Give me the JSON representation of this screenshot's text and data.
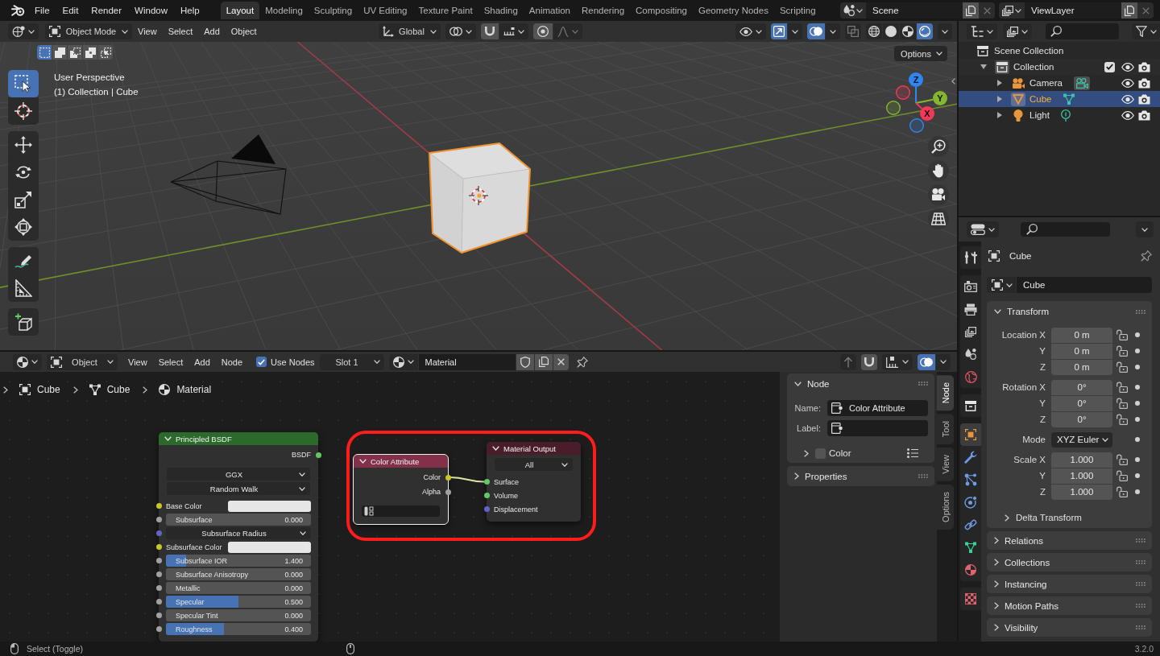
{
  "topbar": {
    "menus": [
      "File",
      "Edit",
      "Render",
      "Window",
      "Help"
    ],
    "workspaces": [
      {
        "label": "Layout",
        "selected": true
      },
      {
        "label": "Modeling",
        "selected": false
      },
      {
        "label": "Sculpting",
        "selected": false
      },
      {
        "label": "UV Editing",
        "selected": false
      },
      {
        "label": "Texture Paint",
        "selected": false
      },
      {
        "label": "Shading",
        "selected": false
      },
      {
        "label": "Animation",
        "selected": false
      },
      {
        "label": "Rendering",
        "selected": false
      },
      {
        "label": "Compositing",
        "selected": false
      },
      {
        "label": "Geometry Nodes",
        "selected": false
      },
      {
        "label": "Scripting",
        "selected": false
      }
    ],
    "scene": "Scene",
    "view_layer": "ViewLayer"
  },
  "viewport": {
    "mode": "Object Mode",
    "menus": [
      "View",
      "Select",
      "Add",
      "Object"
    ],
    "orientation": "Global",
    "gizmos_on": true,
    "overlays_on": true,
    "shading": [
      {
        "kind": "wireframe",
        "selected": false
      },
      {
        "kind": "solid",
        "selected": false
      },
      {
        "kind": "material",
        "selected": false
      },
      {
        "kind": "rendered",
        "selected": true
      }
    ],
    "select_modes": [
      {
        "kind": "set",
        "selected": true
      },
      {
        "kind": "extend",
        "selected": false
      },
      {
        "kind": "subtract",
        "selected": false
      },
      {
        "kind": "invert",
        "selected": false
      },
      {
        "kind": "intersect",
        "selected": false
      }
    ],
    "tool_groups": [
      {
        "tools": [
          {
            "kind": "select_box",
            "selected": true
          },
          {
            "kind": "cursor",
            "selected": false
          }
        ]
      },
      {
        "tools": [
          {
            "kind": "move",
            "selected": false
          },
          {
            "kind": "rotate",
            "selected": false
          },
          {
            "kind": "scale",
            "selected": false
          },
          {
            "kind": "transform",
            "selected": false
          }
        ]
      },
      {
        "tools": [
          {
            "kind": "annotate",
            "selected": false
          },
          {
            "kind": "measure",
            "selected": false
          }
        ]
      },
      {
        "tools": [
          {
            "kind": "add_cube",
            "selected": false
          }
        ]
      }
    ],
    "info": [
      "User Perspective",
      "(1) Collection | Cube"
    ],
    "options": "Options",
    "gizmo_axes": [
      {
        "label": "Z",
        "color": "#2f86f0"
      },
      {
        "label": "Y",
        "color": "#84b62f"
      },
      {
        "label": "X",
        "color": "#f5375a"
      }
    ]
  },
  "node_editor": {
    "shader_type": "Object",
    "menus": [
      "View",
      "Select",
      "Add",
      "Node"
    ],
    "use_nodes": {
      "label": "Use Nodes",
      "checked": true
    },
    "slot": "Slot 1",
    "material": "Material",
    "overlays_on": true,
    "breadcrumbs": [
      {
        "kind": "object",
        "label": "Cube"
      },
      {
        "kind": "mesh",
        "label": "Cube"
      },
      {
        "kind": "material",
        "label": "Material"
      }
    ],
    "nodes": [
      {
        "title": "Principled BSDF",
        "color": "#2c6a2c",
        "selected": false,
        "outputs": [
          {
            "label": "BSDF",
            "color": "#63c763"
          }
        ],
        "options": [
          "GGX",
          "Random Walk"
        ],
        "inputs": [
          {
            "label": "Base Color",
            "color": "#c7c729",
            "kind": "swatch",
            "swatch": {
              "color": "#e6e6e6"
            }
          },
          {
            "label": "Subsurface",
            "color": "#a1a1a1",
            "kind": "slider",
            "value": "0.000",
            "level": 0
          },
          {
            "label": "Subsurface Radius",
            "color": "#6363c7",
            "kind": "vector"
          },
          {
            "label": "Subsurface Color",
            "color": "#c7c729",
            "kind": "swatch",
            "swatch": {
              "color": "#e6e6e6"
            }
          },
          {
            "label": "Subsurface IOR",
            "color": "#a1a1a1",
            "kind": "slider",
            "value": "1.400",
            "level": 0.14
          },
          {
            "label": "Subsurface Anisotropy",
            "color": "#a1a1a1",
            "kind": "slider",
            "value": "0.000",
            "level": 0
          },
          {
            "label": "Metallic",
            "color": "#a1a1a1",
            "kind": "slider",
            "value": "0.000",
            "level": 0
          },
          {
            "label": "Specular",
            "color": "#a1a1a1",
            "kind": "slider",
            "value": "0.500",
            "level": 0.5
          },
          {
            "label": "Specular Tint",
            "color": "#a1a1a1",
            "kind": "slider",
            "value": "0.000",
            "level": 0
          },
          {
            "label": "Roughness",
            "color": "#a1a1a1",
            "kind": "slider",
            "value": "0.400",
            "level": 0.4
          }
        ]
      },
      {
        "title": "Color Attribute",
        "color": "#83314a",
        "selected": true,
        "outputs": [
          {
            "label": "Color",
            "color": "#c7c729"
          },
          {
            "label": "Alpha",
            "color": "#a1a1a1"
          }
        ],
        "fields": [
          {
            "kind": "attribute"
          }
        ]
      },
      {
        "title": "Material Output",
        "color": "#4a1d2a",
        "selected": false,
        "options": [
          "All"
        ],
        "inputs": [
          {
            "label": "Surface",
            "color": "#63c763",
            "kind": "plain"
          },
          {
            "label": "Volume",
            "color": "#63c763",
            "kind": "plain"
          },
          {
            "label": "Displacement",
            "color": "#6363c7",
            "kind": "plain"
          }
        ]
      }
    ]
  },
  "sidebar": {
    "tabs": [
      {
        "label": "Node",
        "selected": true
      },
      {
        "label": "Tool",
        "selected": false
      },
      {
        "label": "View",
        "selected": false
      },
      {
        "label": "Options",
        "selected": false
      }
    ],
    "panels": [
      {
        "title": "Node",
        "expanded": true,
        "fields": [
          {
            "label": "Name:",
            "value": "Color Attribute"
          },
          {
            "label": "Label:"
          }
        ],
        "subpanels": [
          {
            "label": "Color",
            "expanded": false,
            "checked": false
          }
        ]
      },
      {
        "title": "Properties",
        "expanded": false
      }
    ]
  },
  "outliner": {
    "items": [
      {
        "label": "Scene Collection",
        "kind": "scene",
        "selected": false,
        "children": [
          {
            "label": "Collection",
            "kind": "collection",
            "expanded": true,
            "checked": true,
            "selected": false,
            "children": [
              {
                "label": "Camera",
                "kind": "camera",
                "expanded": false,
                "selected": false
              },
              {
                "label": "Cube",
                "kind": "mesh",
                "expanded": false,
                "selected": true
              },
              {
                "label": "Light",
                "kind": "light",
                "expanded": false,
                "selected": false
              }
            ]
          }
        ]
      }
    ]
  },
  "properties": {
    "tab_groups": [
      {
        "tabs": [
          {
            "kind": "tool",
            "selected": false
          }
        ]
      },
      {
        "tabs": [
          {
            "kind": "render",
            "selected": false
          },
          {
            "kind": "output",
            "selected": false
          },
          {
            "kind": "view_layer",
            "selected": false
          },
          {
            "kind": "scene",
            "selected": false
          },
          {
            "kind": "world",
            "selected": false
          }
        ]
      },
      {
        "tabs": [
          {
            "kind": "collection",
            "selected": false
          }
        ]
      },
      {
        "tabs": [
          {
            "kind": "object",
            "selected": true
          },
          {
            "kind": "modifiers",
            "selected": false
          },
          {
            "kind": "particles",
            "selected": false
          },
          {
            "kind": "physics",
            "selected": false
          },
          {
            "kind": "constraints",
            "selected": false
          },
          {
            "kind": "data",
            "selected": false
          },
          {
            "kind": "material",
            "selected": false
          }
        ]
      },
      {
        "tabs": [
          {
            "kind": "texture",
            "selected": false
          }
        ]
      }
    ],
    "context": "Cube",
    "name": "Cube",
    "transform": {
      "title": "Transform",
      "expanded": true,
      "groups": [
        {
          "rows": [
            {
              "label": "Location X",
              "value": "0 m",
              "kind": "number"
            },
            {
              "label": "Y",
              "value": "0 m",
              "kind": "number"
            },
            {
              "label": "Z",
              "value": "0 m",
              "kind": "number"
            }
          ]
        },
        {
          "rows": [
            {
              "label": "Rotation X",
              "value": "0°",
              "kind": "number"
            },
            {
              "label": "Y",
              "value": "0°",
              "kind": "number"
            },
            {
              "label": "Z",
              "value": "0°",
              "kind": "number"
            }
          ]
        },
        {
          "rows": [
            {
              "label": "Mode",
              "value": "XYZ Euler",
              "kind": "dropdown"
            }
          ]
        },
        {
          "rows": [
            {
              "label": "Scale X",
              "value": "1.000",
              "kind": "number"
            },
            {
              "label": "Y",
              "value": "1.000",
              "kind": "number"
            },
            {
              "label": "Z",
              "value": "1.000",
              "kind": "number"
            }
          ]
        }
      ],
      "subpanels": [
        {
          "label": "Delta Transform",
          "expanded": false
        }
      ]
    },
    "panels": [
      {
        "title": "Relations",
        "expanded": false
      },
      {
        "title": "Collections",
        "expanded": false
      },
      {
        "title": "Instancing",
        "expanded": false
      },
      {
        "title": "Motion Paths",
        "expanded": false
      },
      {
        "title": "Visibility",
        "expanded": false
      }
    ]
  },
  "status_bar": {
    "hint": "Select (Toggle)",
    "version": "3.2.0"
  }
}
